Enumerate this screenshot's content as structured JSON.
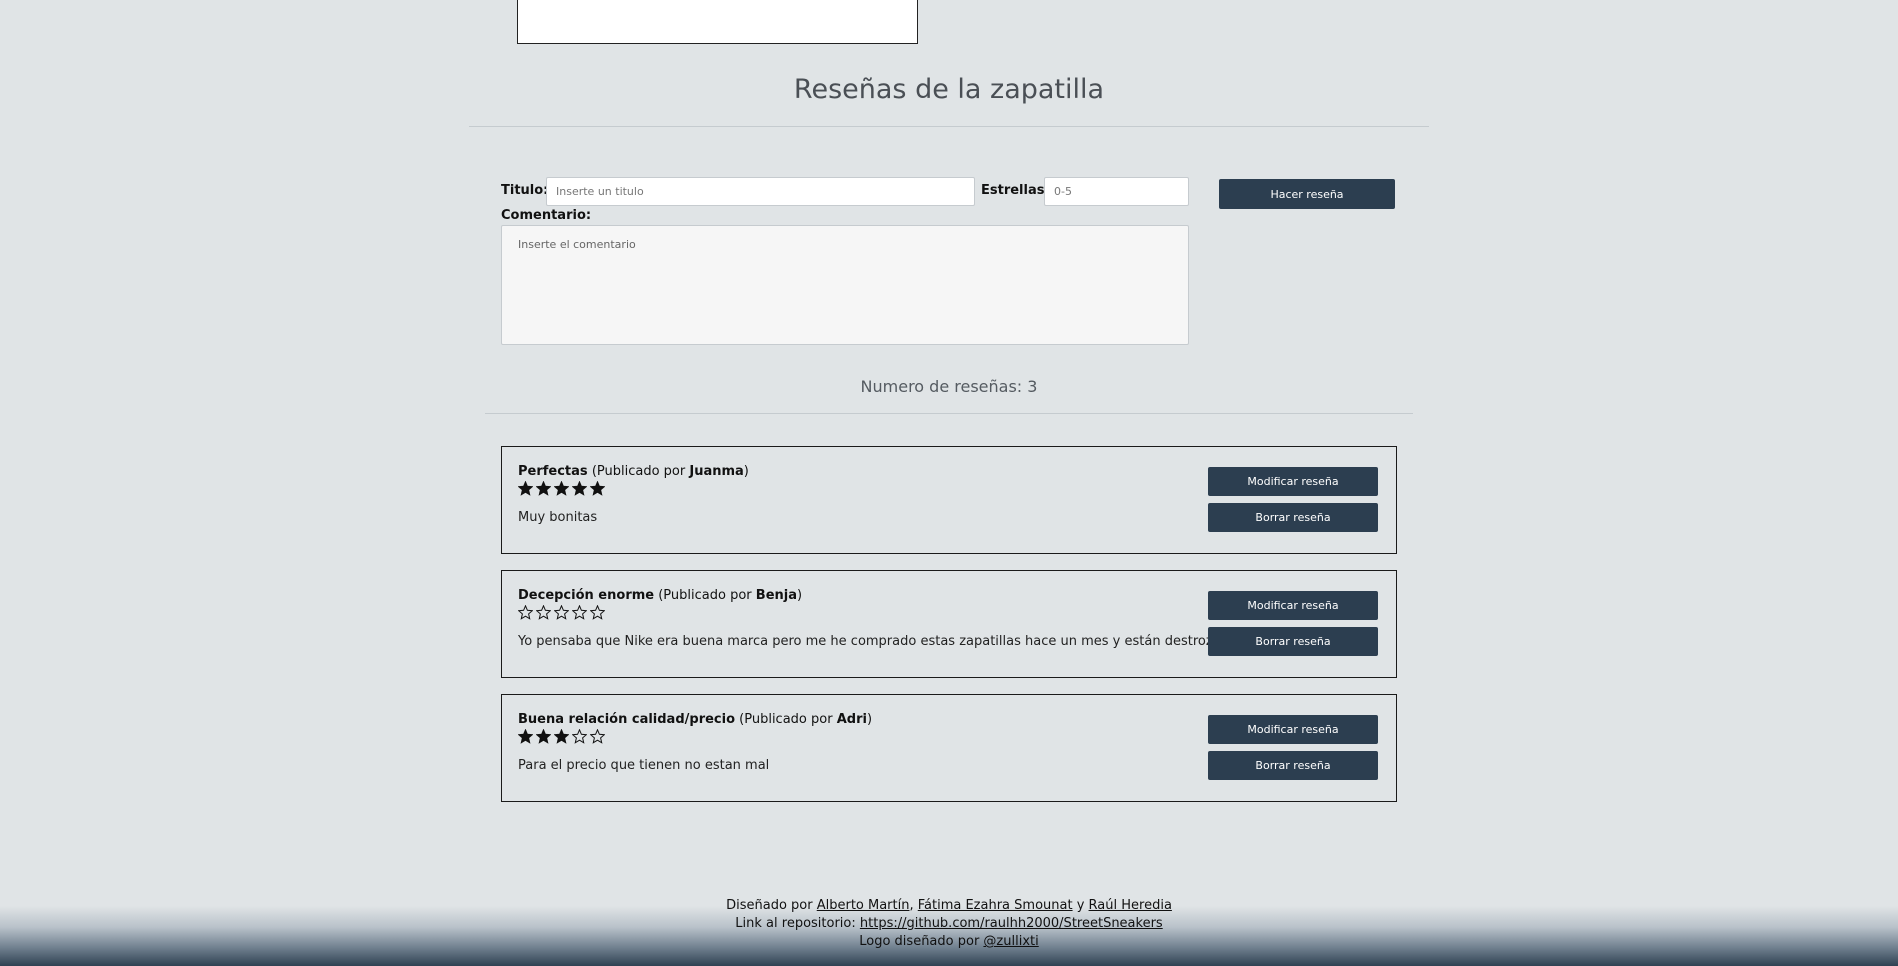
{
  "section": {
    "title": "Reseñas de la zapatilla"
  },
  "form": {
    "title_label": "Titulo:",
    "title_placeholder": "Inserte un titulo",
    "stars_label": "Estrellas:",
    "stars_placeholder": "0-5",
    "comment_label": "Comentario:",
    "comment_placeholder": "Inserte el comentario",
    "submit_label": "Hacer reseña"
  },
  "count_text": "Numero de reseñas: 3",
  "review_common": {
    "published_prefix": "(Publicado por ",
    "published_suffix": ")",
    "modify_label": "Modificar reseña",
    "delete_label": "Borrar reseña"
  },
  "reviews": [
    {
      "title": "Perfectas",
      "author": "Juanma",
      "stars": 5,
      "max_stars": 5,
      "comment": "Muy bonitas"
    },
    {
      "title": "Decepción enorme",
      "author": "Benja",
      "stars": 0,
      "max_stars": 5,
      "comment": "Yo pensaba que Nike era buena marca pero me he comprado estas zapatillas hace un mes y están destrozadas ya"
    },
    {
      "title": "Buena relación calidad/precio",
      "author": "Adri",
      "stars": 3,
      "max_stars": 5,
      "comment": "Para el precio que tienen no estan mal"
    }
  ],
  "footer": {
    "designed_by": "Diseñado por ",
    "author1": "Alberto Martín",
    "sep1": ", ",
    "author2": "Fátima Ezahra Smounat",
    "sep2": " y ",
    "author3": "Raúl Heredia",
    "repo_prefix": "Link al repositorio: ",
    "repo_link": "https://github.com/raulhh2000/StreetSneakers",
    "logo_prefix": "Logo diseñado por ",
    "logo_author": "@zullixti"
  },
  "colors": {
    "background": "#e0e4e6",
    "button": "#2c3e50",
    "star": "#111111"
  }
}
